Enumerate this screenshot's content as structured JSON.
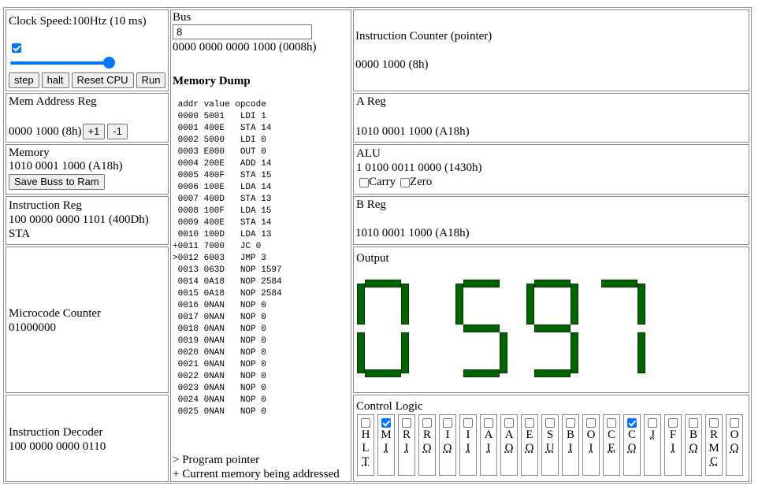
{
  "clock": {
    "label": "Clock Speed:100Htz (10 ms)",
    "enabled": true,
    "slider_percent": 100
  },
  "buttons": {
    "step": "step",
    "halt": "halt",
    "reset": "Reset CPU",
    "run": "Run"
  },
  "mar": {
    "title": "Mem Address Reg",
    "value": "0000 1000 (8h)",
    "inc": "+1",
    "dec": "-1"
  },
  "memory": {
    "title": "Memory",
    "value": "1010 0001 1000 (A18h)",
    "save": "Save Buss to Ram"
  },
  "ir": {
    "title": "Instruction Reg",
    "value": "100 0000 0000 1101 (400Dh)",
    "op": "STA"
  },
  "mc": {
    "title": "Microcode Counter",
    "value": "01000000"
  },
  "decoder": {
    "title": "Instruction Decoder",
    "value": "100 0000 0000 0110"
  },
  "bus": {
    "title": "Bus",
    "input": "8",
    "value": "0000 0000 0000 1000 (0008h)"
  },
  "dump": {
    "title": "Memory Dump",
    "header": " addr value opcode",
    "rows": [
      " 0000 5001   LDI 1",
      " 0001 400E   STA 14",
      " 0002 5000   LDI 0",
      " 0003 E000   OUT 0",
      " 0004 200E   ADD 14",
      " 0005 400F   STA 15",
      " 0006 100E   LDA 14",
      " 0007 400D   STA 13",
      " 0008 100F   LDA 15",
      " 0009 400E   STA 14",
      " 0010 100D   LDA 13",
      "+0011 7000   JC 0",
      ">0012 6003   JMP 3",
      " 0013 063D   NOP 1597",
      " 0014 0A18   NOP 2584",
      " 0015 0A18   NOP 2584",
      " 0016 0NAN   NOP 0",
      " 0017 0NAN   NOP 0",
      " 0018 0NAN   NOP 0",
      " 0019 0NAN   NOP 0",
      " 0020 0NAN   NOP 0",
      " 0021 0NAN   NOP 0",
      " 0022 0NAN   NOP 0",
      " 0023 0NAN   NOP 0",
      " 0024 0NAN   NOP 0",
      " 0025 0NAN   NOP 0"
    ],
    "legend1": "> Program pointer",
    "legend2": "+ Current memory being addressed"
  },
  "ic": {
    "title": "Instruction Counter (pointer)",
    "value": "0000 1000 (8h)"
  },
  "areg": {
    "title": "A Reg",
    "value": "1010 0001 1000 (A18h)"
  },
  "alu": {
    "title": "ALU",
    "value": "1 0100 0011 0000 (1430h)",
    "carry": "Carry",
    "zero": "Zero",
    "carry_on": false,
    "zero_on": false
  },
  "breg": {
    "title": "B Reg",
    "value": "1010 0001 1000 (A18h)"
  },
  "output": {
    "title": "Output",
    "value": "0597",
    "color": "#006400"
  },
  "control": {
    "title": "Control Logic",
    "signals": [
      {
        "lines": [
          "H",
          "L",
          "T"
        ],
        "on": false
      },
      {
        "lines": [
          "M",
          "I"
        ],
        "on": true
      },
      {
        "lines": [
          "R",
          "I"
        ],
        "on": false
      },
      {
        "lines": [
          "R",
          "O"
        ],
        "on": false
      },
      {
        "lines": [
          "I",
          "O"
        ],
        "on": false
      },
      {
        "lines": [
          "I",
          "I"
        ],
        "on": false
      },
      {
        "lines": [
          "A",
          "I"
        ],
        "on": false
      },
      {
        "lines": [
          "A",
          "O"
        ],
        "on": false
      },
      {
        "lines": [
          "E",
          "O"
        ],
        "on": false
      },
      {
        "lines": [
          "S",
          "U"
        ],
        "on": false
      },
      {
        "lines": [
          "B",
          "I"
        ],
        "on": false
      },
      {
        "lines": [
          "O",
          "I"
        ],
        "on": false
      },
      {
        "lines": [
          "C",
          "E"
        ],
        "on": false
      },
      {
        "lines": [
          "C",
          "O"
        ],
        "on": true
      },
      {
        "lines": [
          "J"
        ],
        "on": false
      },
      {
        "lines": [
          "F",
          "I"
        ],
        "on": false
      },
      {
        "lines": [
          "B",
          "O"
        ],
        "on": false
      },
      {
        "lines": [
          "R",
          "M",
          "C"
        ],
        "on": false
      },
      {
        "lines": [
          "O",
          "O"
        ],
        "on": false
      }
    ]
  }
}
